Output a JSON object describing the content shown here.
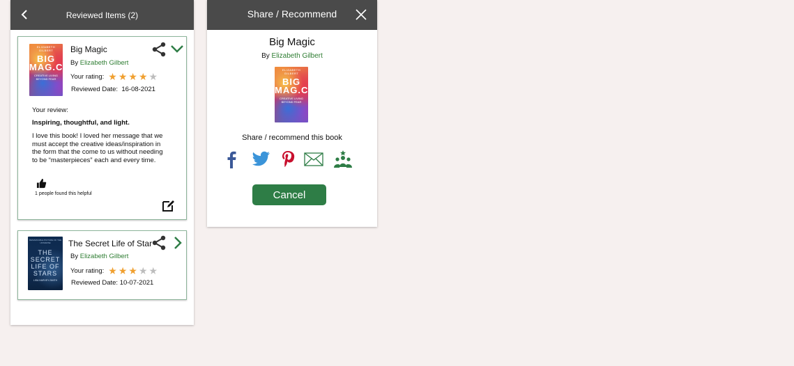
{
  "reviewed_panel": {
    "title": "Reviewed Items (2)",
    "items": [
      {
        "title": "Big Magic",
        "by_prefix": "By",
        "author": "Elizabeth Gilbert",
        "rating_label": "Your rating:",
        "rating": 4,
        "rating_max": 5,
        "reviewed_label": "Reviewed Date:",
        "reviewed_date": "16-08-2021",
        "cover": {
          "author": "ELIZABETH GILBERT",
          "title_1": "BIG",
          "title_2": "MAG.C",
          "subtitle_1": "CREATIVE LIVING",
          "subtitle_2": "BEYOND FEAR"
        },
        "review_label": "Your review:",
        "review_heading": "Inspiring, thoughtful, and light.",
        "review_text": "I love this book! I loved her message that we must accept the creative ideas/inspiration in the form that the come to us without needing to be “masterpieces” each and every time.",
        "helpful_text": "1 people found this helpful"
      },
      {
        "title": "The Secret Life of Star",
        "by_prefix": "By",
        "author": "Elizabeth Gilbert",
        "rating_label": "Your rating:",
        "rating": 3,
        "rating_max": 5,
        "reviewed_label": "Reviewed Date:",
        "reviewed_date": "10-07-2021",
        "cover": {
          "top": "REMARKABLE PICTURE OF THE UNIVERSE",
          "title_1": "THE",
          "title_2": "SECRET",
          "title_3": "LIFE OF",
          "title_4": "STARS",
          "author": "LISA HARVEY-SMITH"
        }
      }
    ]
  },
  "share_panel": {
    "title": "Share / Recommend",
    "book_title": "Big Magic",
    "by_prefix": "By",
    "author": "Elizabeth Gilbert",
    "prompt": "Share / recommend this book",
    "cancel_label": "Cancel",
    "cover": {
      "author": "ELIZABETH GILBERT",
      "title_1": "BIG",
      "title_2": "MAG.C",
      "subtitle_1": "CREATIVE LIVING",
      "subtitle_2": "BEYOND FEAR"
    },
    "networks": [
      "facebook-icon",
      "twitter-icon",
      "pinterest-icon",
      "email-icon",
      "community-icon"
    ]
  },
  "colors": {
    "header_bg": "#4a4a4a",
    "accent_green": "#2e7d46",
    "author_green": "#2e7d32",
    "star_on": "#f0a030",
    "star_off": "#bdbdbd",
    "facebook": "#3b5998",
    "twitter": "#3b94d9",
    "pinterest": "#c8102e",
    "page_bg": "#f6f0ef"
  }
}
